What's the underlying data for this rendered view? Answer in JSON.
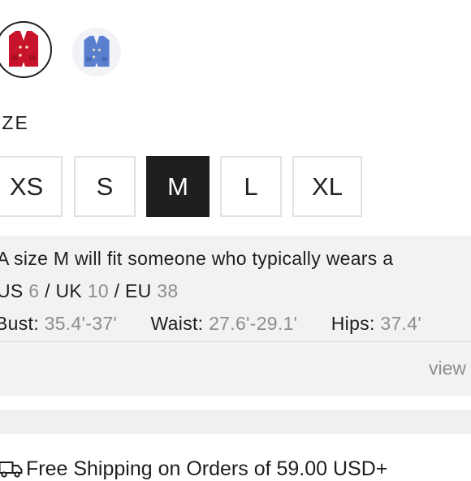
{
  "colors": {
    "swatches": [
      {
        "name": "red-vest-icon",
        "color": "#c8142a",
        "selected": true
      },
      {
        "name": "blue-vest-icon",
        "color": "#5a7fcf",
        "selected": false
      }
    ],
    "selected_border": "#1e1e1e"
  },
  "size": {
    "label": "IZE",
    "options": [
      "XS",
      "S",
      "M",
      "L",
      "XL"
    ],
    "selected": "M"
  },
  "fit": {
    "sentence": "A size M will fit someone who typically wears a",
    "us_label": "US",
    "us_value": "6",
    "sep1": "/",
    "uk_label": "UK",
    "uk_value": "10",
    "sep2": "/",
    "eu_label": "EU",
    "eu_value": "38",
    "bust_label": "Bust:",
    "bust_value": "35.4'-37'",
    "waist_label": "Waist:",
    "waist_value": "27.6'-29.1'",
    "hips_label": "Hips:",
    "hips_value": "37.4'",
    "view_link": "view"
  },
  "shipping": {
    "icon": "truck-icon",
    "text": "Free Shipping on Orders of 59.00 USD+"
  }
}
